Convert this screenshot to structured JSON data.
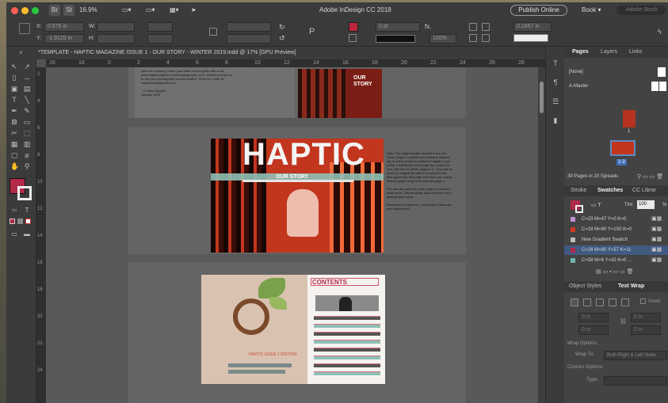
{
  "app": {
    "title": "Adobe InDesign CC 2018",
    "zoom": "16.9%",
    "badges": [
      "Br",
      "St"
    ],
    "publish_label": "Publish Online",
    "workspace": "Book",
    "search_placeholder": "Adobe Stock"
  },
  "control": {
    "x_label": "X:",
    "x_value": "0.875 in",
    "y_label": "Y:",
    "y_value": "-1.9125 in",
    "w_label": "W:",
    "h_label": "H:",
    "stroke_weight": "0 pt",
    "opacity": "100%",
    "gap": "0.1667 in",
    "fill_color": "#c0273a"
  },
  "document": {
    "tab_title": "*TEMPLATE - HAPTIC MAGAZINE ISSUE 1 - OUR STORY - WINTER 2019.indd @ 17% [GPU Preview]",
    "ruler_ticks": [
      "16",
      "18",
      "0",
      "2",
      "4",
      "6",
      "8",
      "10",
      "12",
      "14",
      "16",
      "18",
      "20",
      "22",
      "24",
      "26",
      "28"
    ],
    "vruler_ticks": [
      "2",
      "4",
      "6",
      "8",
      "10",
      "12",
      "14",
      "16",
      "18",
      "20",
      "22",
      "24"
    ]
  },
  "page1": {
    "text_lines": [
      "Need for creating! Share your ideas and projects with us at",
      "www.hapticmagazine.com/hapticgraphic.com ..Would you like us",
      "to see your photography and templates? Send us a note at",
      "hapticmedia@gmail.com",
      "",
      "~S Cindy Nguyen",
      "January 2019"
    ],
    "cover_small_title": [
      "OUR",
      "STORY"
    ]
  },
  "page2": {
    "masthead": "HAPTIC",
    "subtitle": "OUR STORY",
    "side_notes": [
      "Note: You might wonder why there are two",
      "'cover' pages. I created two versions depend-",
      "ing on if this would be printed or digital. If you",
      "prefer a traditional cover page like a print ver-",
      "sion, feel free to delete pages 2-3. If you like to",
      "open up a digital file with a full spread look,",
      "then ignore the first page and when you export",
      "select a page range that excludes page 1.",
      "",
      "You can also add any more pages to create a",
      "book cover. This template does not have a tra-",
      "ditional back cover.",
      "",
      "Remember to have fun, create lots of backups",
      "and experiment!"
    ]
  },
  "page3": {
    "contents_title": "CONTENTS",
    "red_caption": "HAPTIC ISSUE 1 EDITION"
  },
  "panels": {
    "top_tabs": [
      "Pages",
      "Layers",
      "Links"
    ],
    "none_label": "[None]",
    "master_label": "A-Master",
    "page_labels": [
      "1",
      "2-3"
    ],
    "pages_summary": "39 Pages in 20 Spreads",
    "swatch_tabs": [
      "Stroke",
      "Swatches",
      "CC Librar"
    ],
    "tint_label": "Tint:",
    "tint_value": "100",
    "tint_unit": "%",
    "swatches": [
      {
        "name": "C=23 M=47 Y=0 K=0",
        "color": "#c38fd1"
      },
      {
        "name": "C=18 M=90 Y=100 K=0",
        "color": "#cd3b1e"
      },
      {
        "name": "New Gradient Swatch",
        "color": "#bdbdbd"
      },
      {
        "name": "C=26 M=90 Y=57 K=11",
        "color": "#b22a48"
      },
      {
        "name": "C=58 M=6 Y=32 K=0 ...",
        "color": "#6fb6b0"
      }
    ],
    "lower_tabs": [
      "Object Styles",
      "Text Wrap"
    ],
    "wrap_invert": "Invert",
    "wrap_offset": "0 in",
    "wrap_options_label": "Wrap Options:",
    "wrap_to_label": "Wrap To:",
    "wrap_to_value": "Both Right & Left Sides",
    "contour_label": "Contour Options:",
    "type_label": "Type:"
  }
}
